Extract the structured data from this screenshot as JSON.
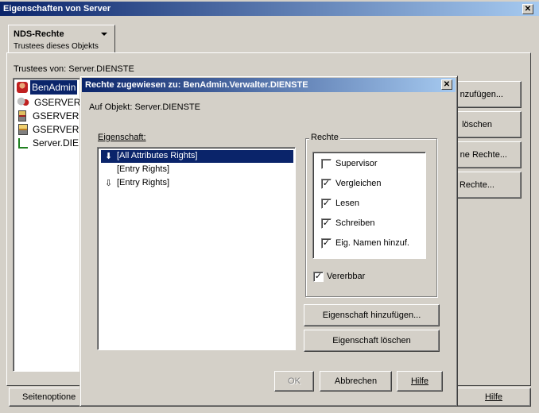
{
  "main_window": {
    "title": "Eigenschaften von Server",
    "close": "✕",
    "tab": {
      "label": "NDS-Rechte",
      "sublabel": "Trustees dieses Objekts"
    },
    "trustees_label": "Trustees von: Server.DIENSTE",
    "trustees": [
      {
        "label": "BenAdmin",
        "icon": "user-icon",
        "selected": true
      },
      {
        "label": "GSERVER",
        "icon": "group-icon"
      },
      {
        "label": "GSERVER",
        "icon": "server-icon"
      },
      {
        "label": "GSERVER",
        "icon": "server-icon"
      },
      {
        "label": "Server.DIE",
        "icon": "tree-icon"
      }
    ],
    "side_buttons": [
      "nzufügen...",
      "löschen",
      "ne Rechte...",
      "Rechte..."
    ],
    "bottom_left_button": "Seitenoptione",
    "bottom_right_button": "Hilfe"
  },
  "dialog": {
    "title": "Rechte zugewiesen zu: BenAdmin.Verwalter.DIENSTE",
    "close": "✕",
    "object_label": "Auf Objekt: Server.DIENSTE",
    "property_label": "Eigenschaft:",
    "properties": [
      {
        "label": "[All Attributes Rights]",
        "icon": "⬇",
        "selected": true
      },
      {
        "label": "[Entry Rights]",
        "icon": ""
      },
      {
        "label": "[Entry Rights]",
        "icon": "⇩"
      }
    ],
    "rights_group_label": "Rechte",
    "rights": [
      {
        "label": "Supervisor",
        "checked": false
      },
      {
        "label": "Vergleichen",
        "checked": true
      },
      {
        "label": "Lesen",
        "checked": true
      },
      {
        "label": "Schreiben",
        "checked": true
      },
      {
        "label": "Eig. Namen hinzuf.",
        "checked": true
      }
    ],
    "inheritable": {
      "label": "Vererbbar",
      "checked": true
    },
    "add_property_button": "Eigenschaft hinzufügen...",
    "delete_property_button": "Eigenschaft löschen",
    "ok_button": "OK",
    "cancel_button": "Abbrechen",
    "help_button": "Hilfe",
    "check_mark": "✓"
  }
}
